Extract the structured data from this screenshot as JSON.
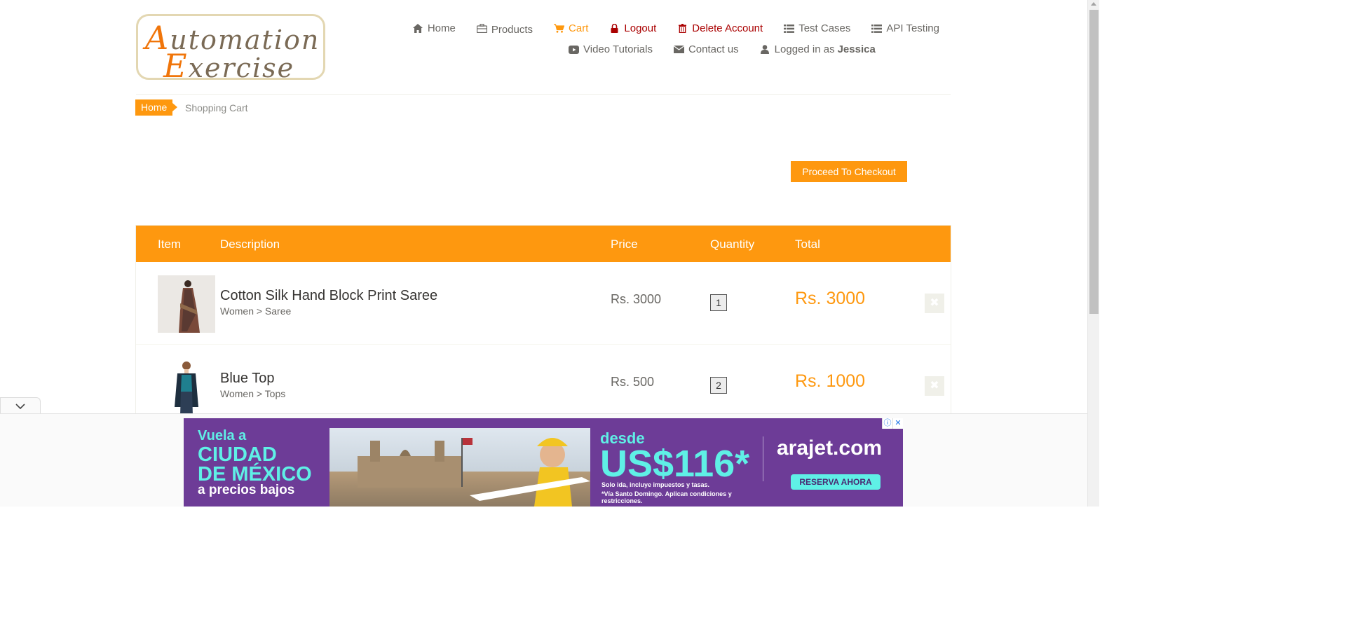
{
  "logo": {
    "line1_cap": "A",
    "line1_rest": "utomation",
    "line2_cap": "E",
    "line2_rest": "xercise"
  },
  "nav": {
    "row1": [
      {
        "label": "Home",
        "icon": "home-icon"
      },
      {
        "label": "Products",
        "icon": "briefcase-icon"
      },
      {
        "label": "Cart",
        "icon": "cart-icon"
      },
      {
        "label": "Logout",
        "icon": "lock-icon"
      },
      {
        "label": "Delete Account",
        "icon": "trash-icon"
      },
      {
        "label": "Test Cases",
        "icon": "list-icon"
      },
      {
        "label": "API Testing",
        "icon": "list-icon"
      }
    ],
    "row2": [
      {
        "label": "Video Tutorials",
        "icon": "youtube-icon"
      },
      {
        "label": "Contact us",
        "icon": "envelope-icon"
      },
      {
        "label": "Logged in as",
        "icon": "user-icon",
        "user": "Jessica"
      }
    ]
  },
  "breadcrumb": {
    "home": "Home",
    "current": "Shopping Cart"
  },
  "checkout_label": "Proceed To Checkout",
  "cart": {
    "headers": [
      "Item",
      "Description",
      "Price",
      "Quantity",
      "Total"
    ],
    "rows": [
      {
        "name": "Cotton Silk Hand Block Print Saree",
        "category": "Women > Saree",
        "price": "Rs. 3000",
        "quantity": "1",
        "total": "Rs. 3000"
      },
      {
        "name": "Blue Top",
        "category": "Women > Tops",
        "price": "Rs. 500",
        "quantity": "2",
        "total": "Rs. 1000"
      }
    ]
  },
  "ad": {
    "line1": "Vuela a",
    "line2": "CIUDAD",
    "line3": "DE MÉXICO",
    "line4": "a precios bajos",
    "desde": "desde",
    "price": "US$116*",
    "note1": "Solo ida, incluye impuestos y tasas.",
    "note2": "*Vía Santo Domingo. Aplican condiciones y restricciones.",
    "brand": "arajet.com",
    "cta": "RESERVA AHORA"
  },
  "colors": {
    "accent": "#fe980f",
    "danger": "#aa0000",
    "ad_bg": "#6d3c97",
    "ad_text": "#5ff0e6"
  }
}
